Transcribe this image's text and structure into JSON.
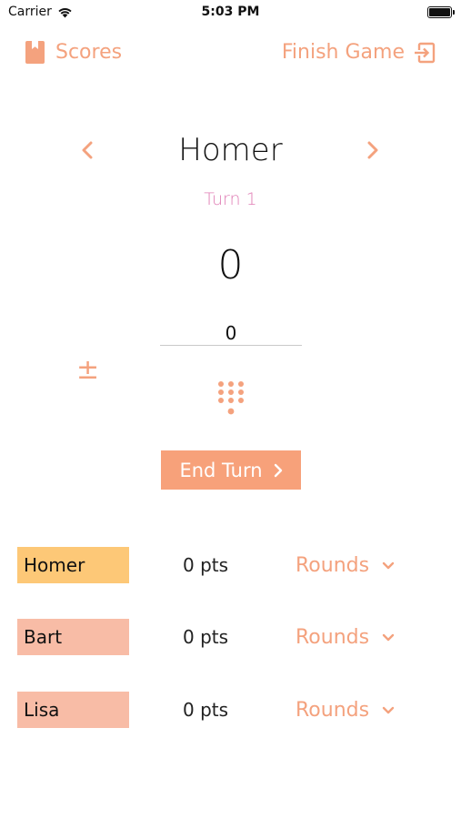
{
  "status_bar": {
    "carrier": "Carrier",
    "time": "5:03 PM"
  },
  "nav": {
    "scores_label": "Scores",
    "finish_label": "Finish Game"
  },
  "current": {
    "player": "Homer",
    "turn": "Turn 1",
    "score": "0",
    "input_value": "0"
  },
  "end_turn_label": "End Turn",
  "players": [
    {
      "name": "Homer",
      "pts": "0 pts",
      "rounds": "Rounds",
      "color": "#fdc877"
    },
    {
      "name": "Bart",
      "pts": "0 pts",
      "rounds": "Rounds",
      "color": "#f8bca6"
    },
    {
      "name": "Lisa",
      "pts": "0 pts",
      "rounds": "Rounds",
      "color": "#f8bca6"
    }
  ],
  "accent": "#f4a27e",
  "turn_color": "#e07fb6"
}
